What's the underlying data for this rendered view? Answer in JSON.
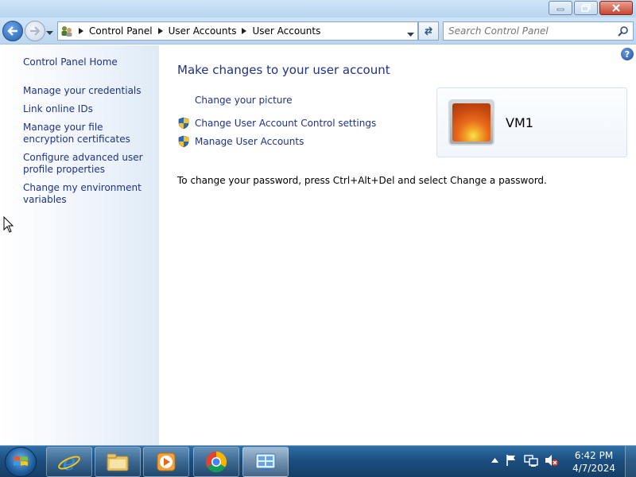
{
  "window": {
    "title": "",
    "controls": [
      "minimize",
      "maximize",
      "close"
    ]
  },
  "navbar": {
    "breadcrumb": [
      "Control Panel",
      "User Accounts",
      "User Accounts"
    ],
    "search": {
      "placeholder": "Search Control Panel",
      "value": ""
    }
  },
  "sidebar": {
    "home_label": "Control Panel Home",
    "items": [
      {
        "label": "Manage your credentials"
      },
      {
        "label": "Link online IDs"
      },
      {
        "label": "Manage your file encryption certificates"
      },
      {
        "label": "Configure advanced user profile properties"
      },
      {
        "label": "Change my environment variables"
      }
    ]
  },
  "main": {
    "title": "Make changes to your user account",
    "tasks": [
      {
        "label": "Change your picture",
        "icon": ""
      },
      {
        "label": "Change User Account Control settings",
        "icon": "shield-icon"
      },
      {
        "label": "Manage User Accounts",
        "icon": "shield-icon"
      }
    ],
    "password_note": "To change your password, press Ctrl+Alt+Del and select Change a password.",
    "user": {
      "name": "VM1",
      "picture": "flower-icon"
    },
    "help_icon": "?"
  },
  "taskbar": {
    "apps": [
      {
        "name": "internet-explorer-icon"
      },
      {
        "name": "file-explorer-icon"
      },
      {
        "name": "media-player-icon"
      },
      {
        "name": "chrome-icon"
      },
      {
        "name": "control-panel-icon",
        "active": true
      }
    ],
    "clock": {
      "time": "6:42 PM",
      "date": "4/7/2024"
    }
  },
  "colors": {
    "link": "#1e3287",
    "taskbar": "#1b4f80",
    "chrome": "#bcd6ef"
  }
}
